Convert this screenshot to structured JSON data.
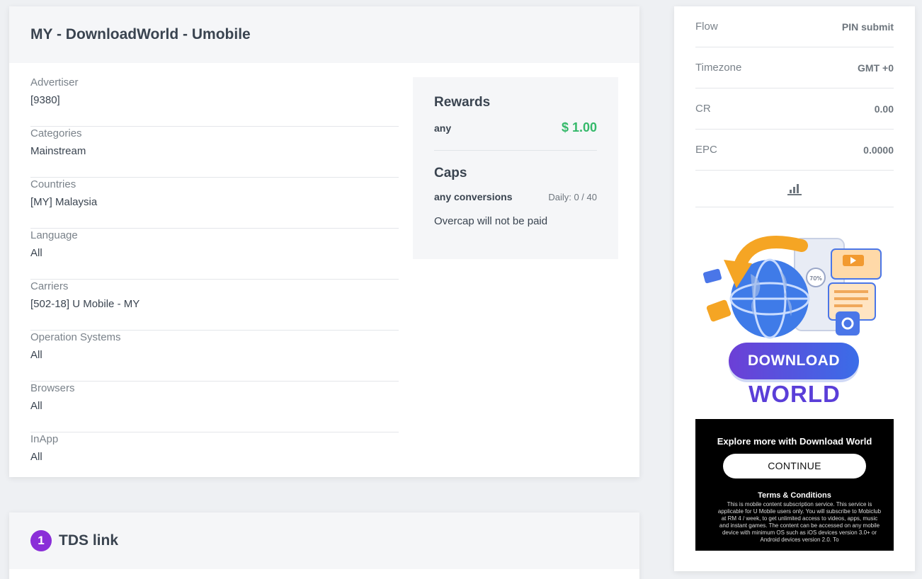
{
  "offer": {
    "title": "MY - DownloadWorld - Umobile",
    "details": [
      {
        "label": "Advertiser",
        "value": "[9380]"
      },
      {
        "label": "Categories",
        "value": "Mainstream"
      },
      {
        "label": "Countries",
        "value": "[MY] Malaysia"
      },
      {
        "label": "Language",
        "value": "All"
      },
      {
        "label": "Carriers",
        "value": "[502-18] U Mobile - MY"
      },
      {
        "label": "Operation Systems",
        "value": "All"
      },
      {
        "label": "Browsers",
        "value": "All"
      },
      {
        "label": "InApp",
        "value": "All"
      }
    ],
    "rewards": {
      "heading": "Rewards",
      "type": "any",
      "value": "$ 1.00"
    },
    "caps": {
      "heading": "Caps",
      "type": "any conversions",
      "value": "Daily: 0 / 40",
      "note": "Overcap will not be paid"
    }
  },
  "tds": {
    "step": "1",
    "title": "TDS link"
  },
  "sidebar": {
    "stats": [
      {
        "label": "Flow",
        "value": "PIN submit"
      },
      {
        "label": "Timezone",
        "value": "GMT +0"
      },
      {
        "label": "CR",
        "value": "0.00"
      },
      {
        "label": "EPC",
        "value": "0.0000"
      }
    ],
    "chart_icon": "bar-chart-icon",
    "promo": {
      "brand_line1": "DOWNLOAD",
      "brand_line2": "WORLD",
      "badge": "70%",
      "tagline": "Explore more with Download World",
      "cta": "CONTINUE",
      "terms_title": "Terms & Conditions",
      "terms_text": "This is mobile content subscription service. This service is applicable for U Mobile users only. You will subscribe to Mobiclub at RM 4 / week, to get unlimited access to videos, apps, music and instant games. The content can be accessed on any mobile device with minimum OS such as iOS devices version 3.0+ or Android devices version 2.0. To"
    }
  },
  "colors": {
    "reward_green": "#35b96a",
    "step_purple": "#8a2ed8",
    "page_bg": "#eef0f3"
  }
}
